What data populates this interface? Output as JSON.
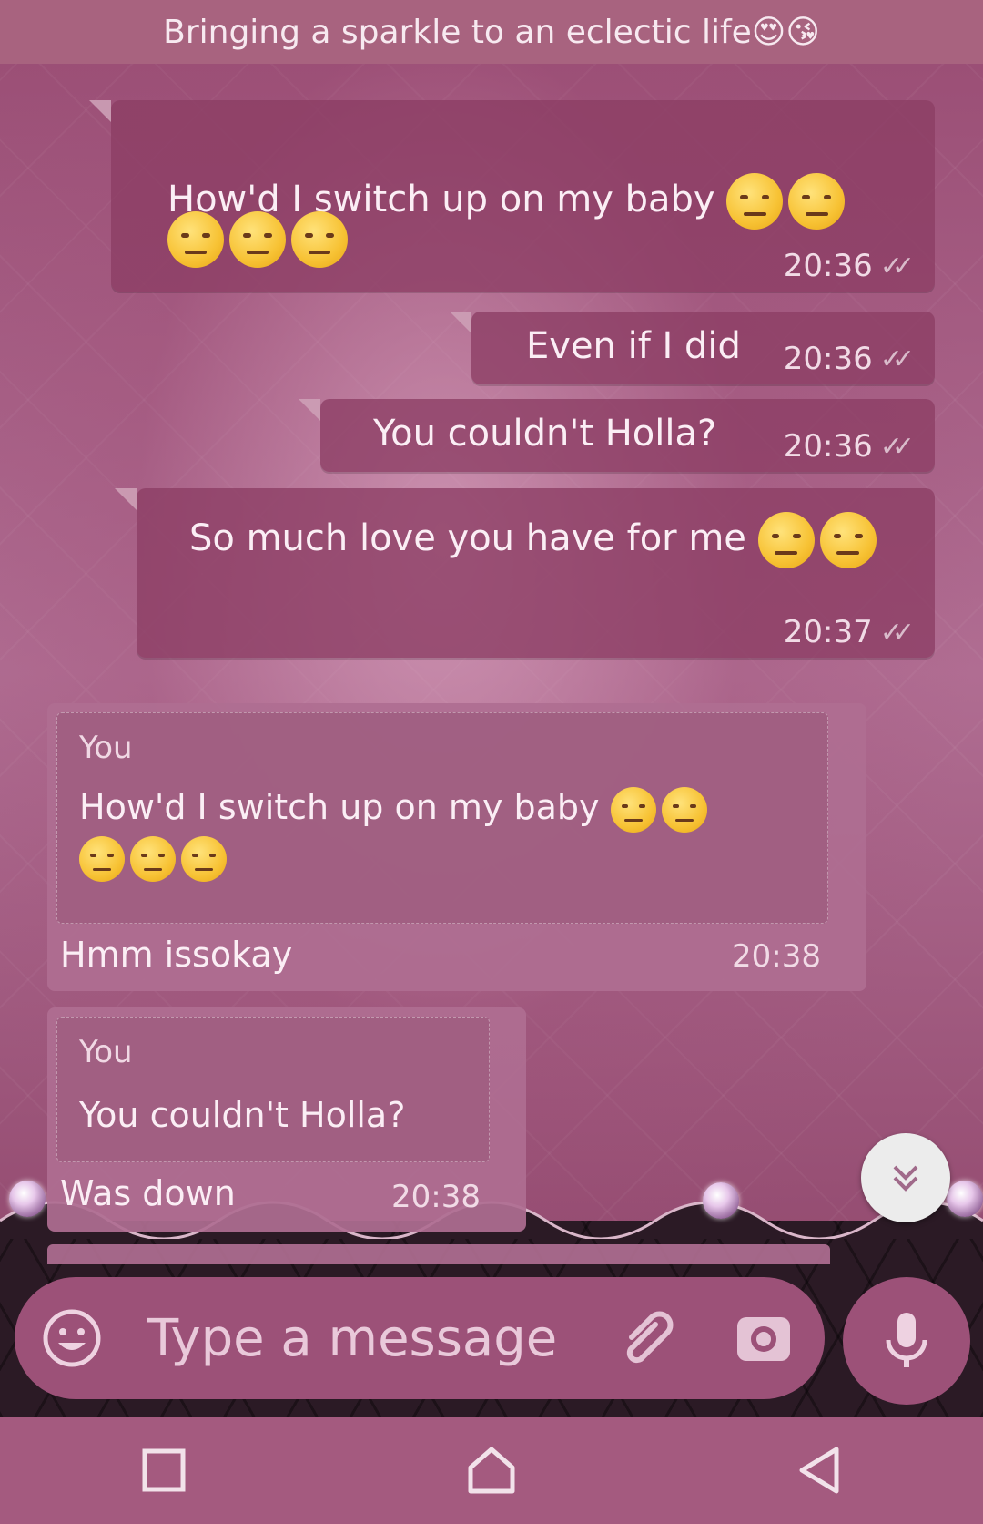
{
  "header": {
    "status_text": "Bringing a sparkle to an eclectic life😍😘"
  },
  "messages": [
    {
      "text": "How'd I switch up on my baby",
      "time": "20:36"
    },
    {
      "text": "Even if I did",
      "time": "20:36"
    },
    {
      "text": "You couldn't Holla?",
      "time": "20:36"
    },
    {
      "text": "So much love you have for me",
      "time": "20:37"
    }
  ],
  "replies": [
    {
      "quote_author": "You",
      "quote_text": "How'd I switch up on my baby",
      "text": "Hmm issokay",
      "time": "20:38"
    },
    {
      "quote_author": "You",
      "quote_text": "You couldn't Holla?",
      "text": "Was down",
      "time": "20:38"
    }
  ],
  "composer": {
    "placeholder": "Type a message",
    "icons": [
      "emoji-icon",
      "attach-icon",
      "camera-icon",
      "mic-icon"
    ]
  },
  "navigation": {
    "icons": [
      "recents-icon",
      "home-icon",
      "back-icon"
    ]
  },
  "colors": {
    "header": "#a8637f",
    "bubble": "#8c3e64",
    "reply_bubble": "#af6e91",
    "input": "#9c5178",
    "nav": "#a45a7f"
  }
}
